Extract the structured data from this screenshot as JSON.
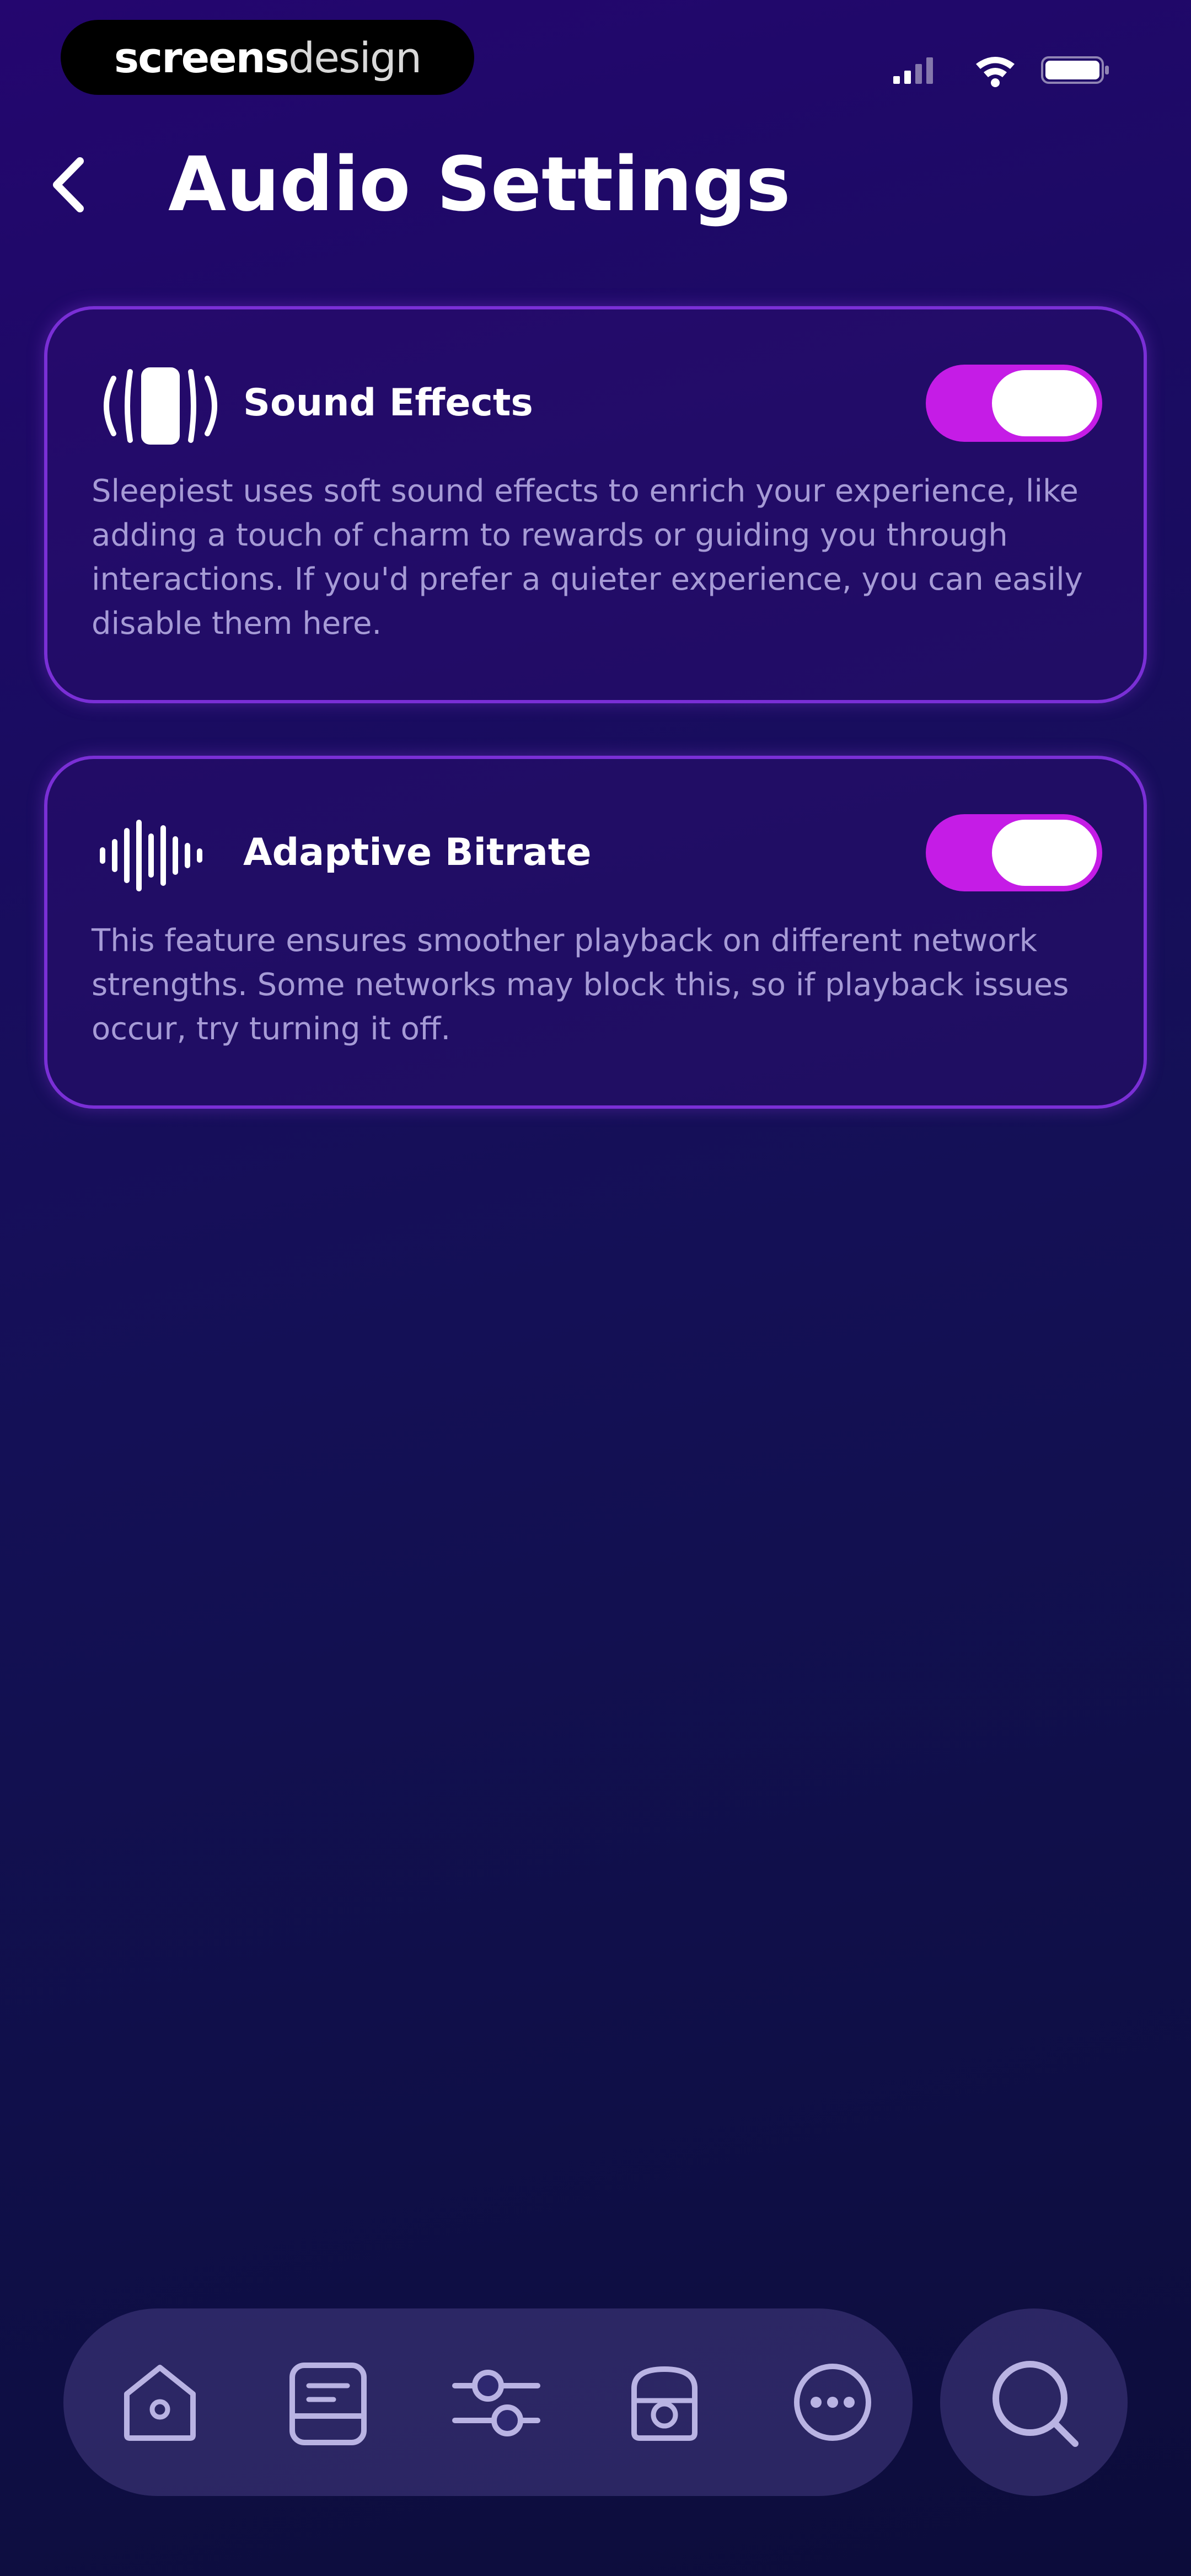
{
  "status_bar": {
    "brand_bold": "screens",
    "brand_light": "design",
    "signal_icon": "signal-icon",
    "wifi_icon": "wifi-icon",
    "battery_icon": "battery-icon"
  },
  "header": {
    "back_icon": "chevron-left-icon",
    "title": "Audio Settings"
  },
  "settings": [
    {
      "icon": "speaker-icon",
      "title": "Sound Effects",
      "enabled": true,
      "description": "Sleepiest uses soft sound effects to enrich your experience, like adding a touch of charm to rewards or guiding you through interactions. If you'd prefer a quieter experience, you can easily disable them here."
    },
    {
      "icon": "waveform-icon",
      "title": "Adaptive Bitrate",
      "enabled": true,
      "description": "This feature ensures smoother playback on different network strengths. Some networks may block this, so if playback issues occur, try turning it off."
    }
  ],
  "bottom_nav": {
    "items": [
      {
        "icon": "home-icon"
      },
      {
        "icon": "library-icon"
      },
      {
        "icon": "mixer-icon"
      },
      {
        "icon": "radio-icon"
      },
      {
        "icon": "more-icon"
      }
    ],
    "search_icon": "search-icon"
  },
  "colors": {
    "accent": "#c51ce6",
    "card_border": "#7a2fd6",
    "description_text": "#a69bd6",
    "background_top": "#24066f",
    "background_bottom": "#0c0c3a"
  }
}
